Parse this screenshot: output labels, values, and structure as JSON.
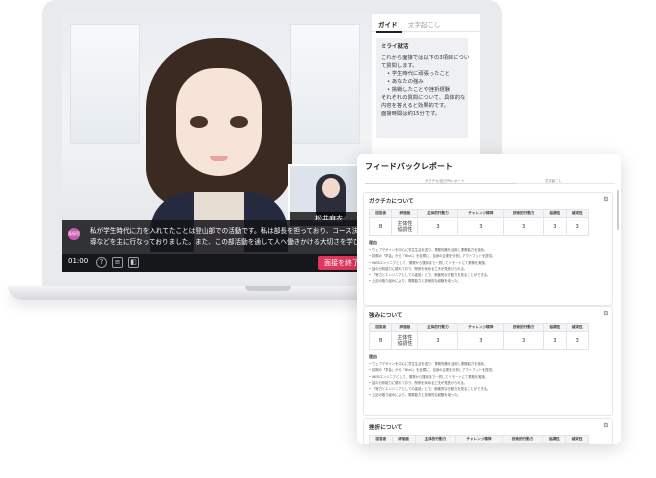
{
  "screen": {
    "subtitle_icon": "面接官",
    "subtitle_lines": [
      "私が学生時代に力を入れてたことは登山部での活動です。私は部長を担っており、コース決めや登山時の先",
      "導などを主に行なっておりました。また、この部活動を通して人へ働きかける大切さを学びました。"
    ],
    "time": "01:00",
    "end_button": "面接を終了",
    "pip_name": "松井麻衣",
    "icons": [
      "help-icon",
      "chat-icon",
      "layout-icon"
    ]
  },
  "guide": {
    "tabs": [
      "ガイド",
      "文字起こし"
    ],
    "card_title": "ミライ就活",
    "intro_lines": [
      "これから面接では以下の3項目につい",
      "て質問します。"
    ],
    "bullets": [
      "学生時代に頑張ったこと",
      "あなたの強み",
      "挑戦したことや挫折経験"
    ],
    "outro_lines": [
      "それぞれの質問について、具体的な",
      "内容を答えると効果的です。",
      "面接時間は約15分です。"
    ]
  },
  "report": {
    "title": "フィードバックレポート",
    "tabs": [
      "ガクチカ/自己PRレポート",
      "文字起こし"
    ],
    "columns": [
      "回答者",
      "評価板",
      "主体的行動力",
      "チャレンジ精神",
      "技術的行動力",
      "協調性",
      "誠実性"
    ],
    "sections": [
      {
        "title": "ガクチカについて",
        "grade": "B",
        "sub_labels": [
          "主体性",
          "協調性"
        ],
        "scores": [
          "3",
          "3",
          "3",
          "3",
          "3"
        ],
        "label": "理由",
        "bullets": [
          "ウェブデザインを中心に学生生活を送り、業務知識を活用し業務能力を強化。",
          "初期の「学会」から「BtoC」を目標に、自身の企業を分析しアウトプットを提供。",
          "WEBエンジニアとして、開発から運用まで一貫してリモートにて業務を実施。",
          "話の分析能力に優れており、関係を深める工夫が見受けられる。",
          "「努力とエンジニアとしての姿勢」とで、積極的な行動力を見ることができる。",
          "上記の取り組みにより、開発能力と技術的な経験を培った。"
        ]
      },
      {
        "title": "強みについて",
        "grade": "B",
        "sub_labels": [
          "主体性",
          "協調性"
        ],
        "scores": [
          "3",
          "3",
          "3",
          "3",
          "3"
        ],
        "label": "理由",
        "bullets": [
          "ウェブデザインを中心に学生生活を送り、業務知識を活用し業務能力を強化。",
          "初期の「学会」から「BtoC」を目標に、自身の企業を分析しアウトプットを提供。",
          "WEBエンジニアとして、開発から運用まで一貫してリモートにて業務を実施。",
          "話の分析能力に優れており、関係を深める工夫が見受けられる。",
          "「努力とエンジニアとしての姿勢」とで、積極的な行動力を見ることができる。",
          "上記の取り組みにより、開発能力と技術的な経験を培った。"
        ]
      },
      {
        "title": "挫折について"
      }
    ]
  }
}
